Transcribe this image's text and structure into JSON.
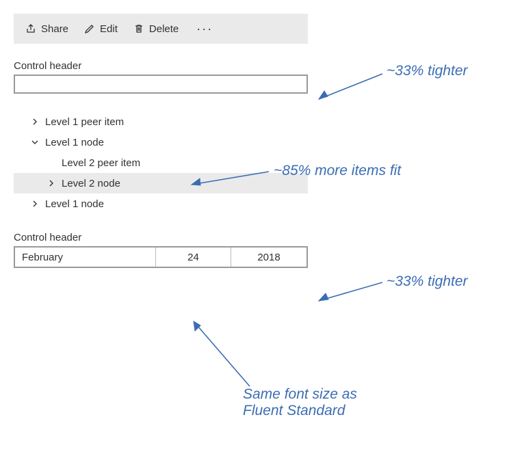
{
  "cmdbar": {
    "share": "Share",
    "edit": "Edit",
    "delete": "Delete"
  },
  "textbox": {
    "header": "Control header",
    "value": ""
  },
  "tree": {
    "items": [
      {
        "label": "Level 1 peer item",
        "expanded": false,
        "indent": 1,
        "hasChildren": true
      },
      {
        "label": "Level 1 node",
        "expanded": true,
        "indent": 1,
        "hasChildren": true
      },
      {
        "label": "Level 2 peer item",
        "expanded": false,
        "indent": 2,
        "hasChildren": false
      },
      {
        "label": "Level 2 node",
        "expanded": false,
        "indent": 2,
        "hasChildren": true,
        "selected": true
      },
      {
        "label": "Level 1 node",
        "expanded": false,
        "indent": 1,
        "hasChildren": true
      }
    ]
  },
  "datepicker": {
    "header": "Control header",
    "month": "February",
    "day": "24",
    "year": "2018"
  },
  "annotations": {
    "a1": "~33% tighter",
    "a2": "~85% more items fit",
    "a3": "~33% tighter",
    "a4_line1": "Same font size as",
    "a4_line2": "Fluent Standard"
  }
}
